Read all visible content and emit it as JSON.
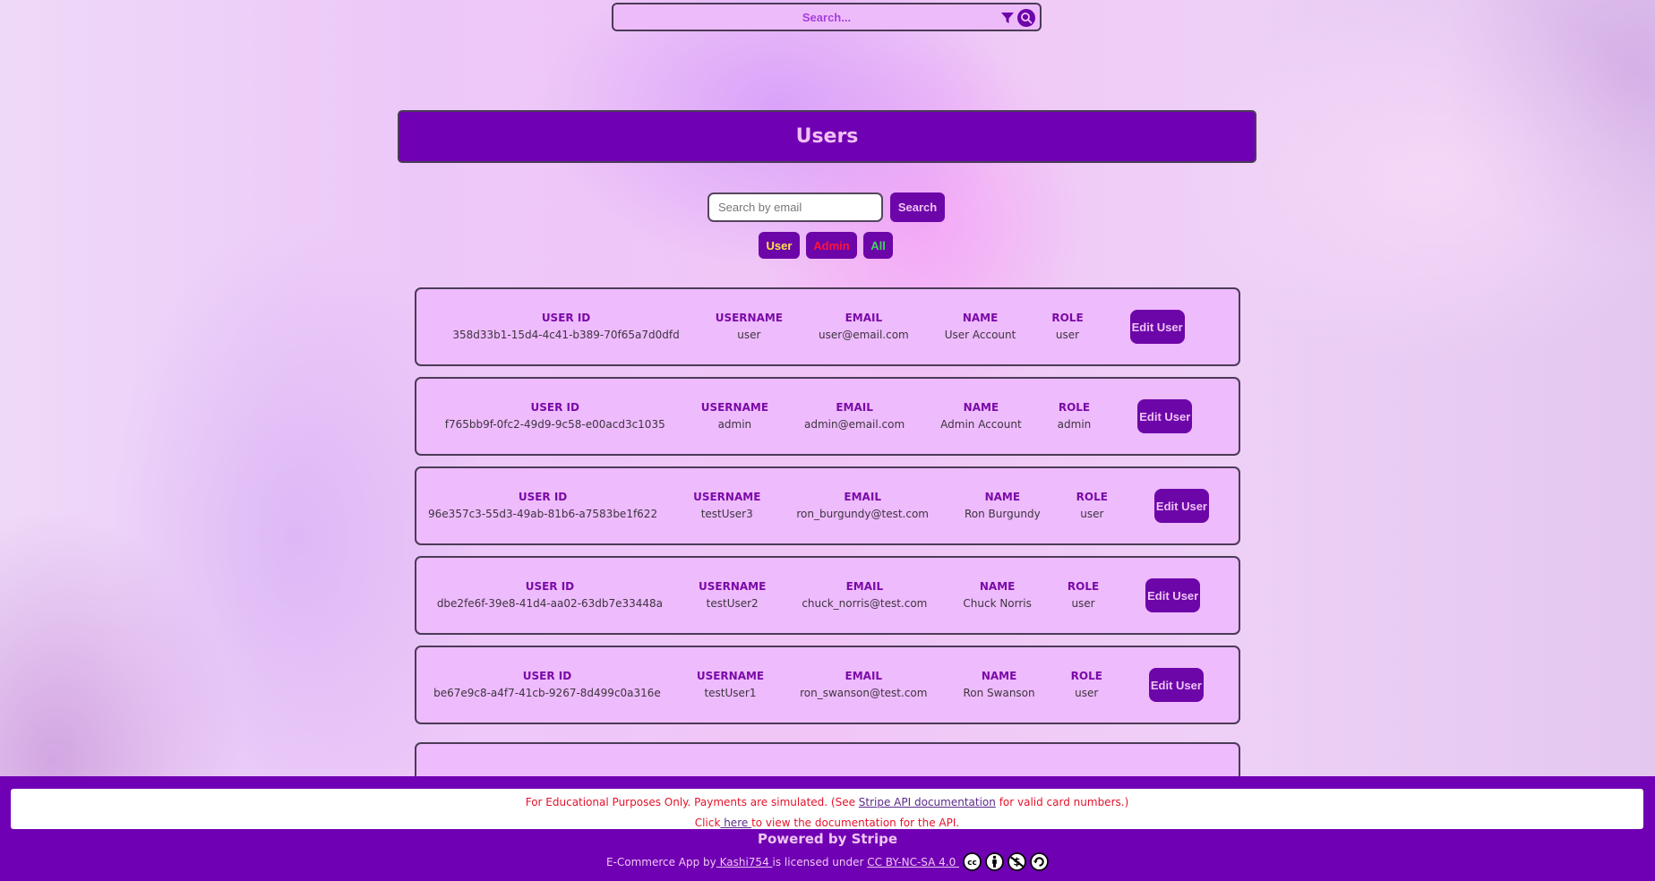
{
  "top_search": {
    "placeholder": "Search...",
    "filter_icon": "filter-icon",
    "search_icon": "search-icon"
  },
  "header": {
    "title": "Users"
  },
  "email_search": {
    "placeholder": "Search by email",
    "value": "",
    "button_label": "Search"
  },
  "role_filters": [
    {
      "label": "User",
      "color": "#ffe04a"
    },
    {
      "label": "Admin",
      "color": "#ff1338"
    },
    {
      "label": "All",
      "color": "#3fd55b"
    }
  ],
  "columns": {
    "user_id": "USER ID",
    "username": "USERNAME",
    "email": "EMAIL",
    "name": "NAME",
    "role": "ROLE"
  },
  "edit_label": "Edit User",
  "users": [
    {
      "user_id": "358d33b1-15d4-4c41-b389-70f65a7d0dfd",
      "username": "user",
      "email": "user@email.com",
      "name": "User Account",
      "role": "user"
    },
    {
      "user_id": "f765bb9f-0fc2-49d9-9c58-e00acd3c1035",
      "username": "admin",
      "email": "admin@email.com",
      "name": "Admin Account",
      "role": "admin"
    },
    {
      "user_id": "96e357c3-55d3-49ab-81b6-a7583be1f622",
      "username": "testUser3",
      "email": "ron_burgundy@test.com",
      "name": "Ron Burgundy",
      "role": "user"
    },
    {
      "user_id": "dbe2fe6f-39e8-41d4-aa02-63db7e33448a",
      "username": "testUser2",
      "email": "chuck_norris@test.com",
      "name": "Chuck Norris",
      "role": "user"
    },
    {
      "user_id": "be67e9c8-a4f7-41cb-9267-8d499c0a316e",
      "username": "testUser1",
      "email": "ron_swanson@test.com",
      "name": "Ron Swanson",
      "role": "user"
    }
  ],
  "footer": {
    "notice_line1_pre": "For Educational Purposes Only. Payments are simulated. (See ",
    "notice_line1_link": "Stripe API documentation",
    "notice_line1_post": " for valid card numbers.)",
    "notice_line2_pre": "Click",
    "notice_line2_link": " here ",
    "notice_line2_post": "to view the documentation for the API.",
    "powered_by": "Powered by Stripe",
    "license_pre": "E-Commerce App by",
    "license_author": " Kashi754 ",
    "license_mid": "is licensed under ",
    "license_link": "CC BY-NC-SA 4.0 ",
    "license_icons": [
      "cc-icon",
      "by-icon",
      "nc-icon",
      "sa-icon"
    ]
  },
  "colors": {
    "brand": "#7000b3",
    "card_bg": "#eebbfc",
    "label": "#7a0aa8",
    "notice_text": "#e3132b"
  }
}
